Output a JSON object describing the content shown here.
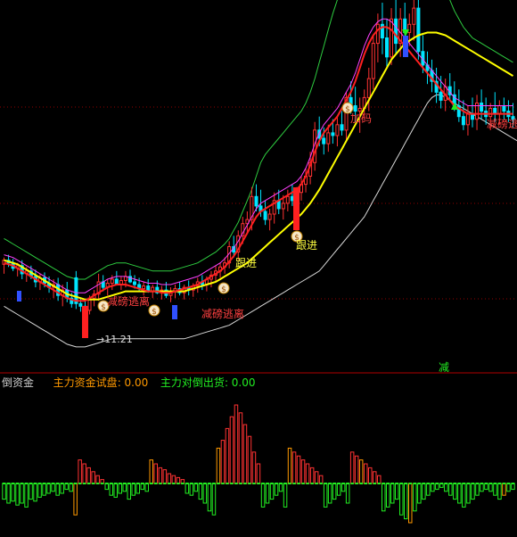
{
  "colors": {
    "background": "#000000",
    "rise": "#ff3232",
    "fall": "#00e5ff",
    "ma_yellow": "#ffff00",
    "ma_red": "#ff2020",
    "ma_magenta": "#ff40ff",
    "band_upper": "#2ecc40",
    "band_lower": "#d8d8d8",
    "separator": "#b00000",
    "grid": "#900000",
    "bar_green": "#22ee22",
    "bar_orange": "#ff9900",
    "label_orange": "#ff9900",
    "label_green": "#22ee22",
    "label_grey": "#cccccc"
  },
  "main_panel": {
    "low_label": "11.21",
    "annotations": [
      {
        "text": "加码",
        "color": "#ff4040"
      },
      {
        "text": "跟进",
        "color": "#ffff40"
      },
      {
        "text": "跟进",
        "color": "#ffff40"
      },
      {
        "text": "减",
        "color": "#22ee22"
      },
      {
        "text": "减磅逃离",
        "color": "#ff4040"
      },
      {
        "text": "减磅逃离",
        "color": "#ff4040"
      },
      {
        "text": "减磅逃离",
        "color": "#ff4040"
      }
    ]
  },
  "sub_panel": {
    "title": "倒资金",
    "items": [
      {
        "label": "主力资金试盘",
        "value": "0.00",
        "color": "#ff9900"
      },
      {
        "label": "主力对倒出货",
        "value": "0.00",
        "color": "#22ee22"
      }
    ]
  },
  "chart_data": {
    "type": "candlestick",
    "candles": [
      {
        "o": 5,
        "h": 10,
        "l": -2,
        "c": 8
      },
      {
        "o": 8,
        "h": 12,
        "l": 3,
        "c": 6
      },
      {
        "o": 6,
        "h": 9,
        "l": 0,
        "c": 2
      },
      {
        "o": 2,
        "h": 6,
        "l": -4,
        "c": 4
      },
      {
        "o": 4,
        "h": 8,
        "l": -6,
        "c": -2
      },
      {
        "o": -2,
        "h": 3,
        "l": -8,
        "c": 0
      },
      {
        "o": 0,
        "h": 4,
        "l": -6,
        "c": -4
      },
      {
        "o": -4,
        "h": 1,
        "l": -12,
        "c": -8
      },
      {
        "o": -8,
        "h": -2,
        "l": -14,
        "c": -5
      },
      {
        "o": -5,
        "h": -1,
        "l": -12,
        "c": -9
      },
      {
        "o": -9,
        "h": -4,
        "l": -16,
        "c": -12
      },
      {
        "o": -12,
        "h": -6,
        "l": -20,
        "c": -10
      },
      {
        "o": -10,
        "h": -5,
        "l": -22,
        "c": -18
      },
      {
        "o": -18,
        "h": -10,
        "l": -26,
        "c": -14
      },
      {
        "o": -14,
        "h": -8,
        "l": -23,
        "c": -20
      },
      {
        "o": -20,
        "h": -16,
        "l": -27,
        "c": -24
      },
      {
        "o": -5,
        "h": 0,
        "l": -28,
        "c": -24
      },
      {
        "o": -24,
        "h": -20,
        "l": -30,
        "c": -26
      },
      {
        "o": -26,
        "h": -22,
        "l": -33,
        "c": -29
      },
      {
        "o": -29,
        "h": -18,
        "l": -32,
        "c": -20
      },
      {
        "o": -20,
        "h": -14,
        "l": -26,
        "c": -17
      },
      {
        "o": -17,
        "h": -2,
        "l": -22,
        "c": -8
      },
      {
        "o": -8,
        "h": -3,
        "l": -15,
        "c": -12
      },
      {
        "o": -12,
        "h": -6,
        "l": -18,
        "c": -9
      },
      {
        "o": -9,
        "h": -3,
        "l": -14,
        "c": -6
      },
      {
        "o": -6,
        "h": 0,
        "l": -10,
        "c": -10
      },
      {
        "o": -10,
        "h": -4,
        "l": -14,
        "c": -7
      },
      {
        "o": -7,
        "h": 0,
        "l": -12,
        "c": -4
      },
      {
        "o": -4,
        "h": 1,
        "l": -9,
        "c": -8
      },
      {
        "o": -8,
        "h": -3,
        "l": -13,
        "c": -10
      },
      {
        "o": -10,
        "h": -5,
        "l": -15,
        "c": -13
      },
      {
        "o": -13,
        "h": -8,
        "l": -18,
        "c": -11
      },
      {
        "o": -11,
        "h": -6,
        "l": -16,
        "c": -15
      },
      {
        "o": -15,
        "h": -10,
        "l": -20,
        "c": -12
      },
      {
        "o": -12,
        "h": -7,
        "l": -17,
        "c": -16
      },
      {
        "o": -16,
        "h": -11,
        "l": -21,
        "c": -14
      },
      {
        "o": -14,
        "h": -8,
        "l": -20,
        "c": -18
      },
      {
        "o": -18,
        "h": -12,
        "l": -23,
        "c": -15
      },
      {
        "o": -15,
        "h": -10,
        "l": -20,
        "c": -13
      },
      {
        "o": -13,
        "h": -8,
        "l": -18,
        "c": -16
      },
      {
        "o": -16,
        "h": -10,
        "l": -21,
        "c": -12
      },
      {
        "o": -12,
        "h": -7,
        "l": -18,
        "c": -14
      },
      {
        "o": -14,
        "h": -9,
        "l": -19,
        "c": -11
      },
      {
        "o": -11,
        "h": -5,
        "l": -16,
        "c": -8
      },
      {
        "o": -8,
        "h": -3,
        "l": -14,
        "c": -10
      },
      {
        "o": -10,
        "h": -4,
        "l": -15,
        "c": -6
      },
      {
        "o": -6,
        "h": 0,
        "l": -12,
        "c": -3
      },
      {
        "o": -3,
        "h": 4,
        "l": -8,
        "c": 0
      },
      {
        "o": 0,
        "h": 6,
        "l": -5,
        "c": 3
      },
      {
        "o": 3,
        "h": 10,
        "l": -2,
        "c": 6
      },
      {
        "o": 6,
        "h": 22,
        "l": 2,
        "c": 18
      },
      {
        "o": 18,
        "h": 26,
        "l": 10,
        "c": 14
      },
      {
        "o": 14,
        "h": 30,
        "l": 8,
        "c": 26
      },
      {
        "o": 26,
        "h": 40,
        "l": 20,
        "c": 35
      },
      {
        "o": 35,
        "h": 44,
        "l": 28,
        "c": 38
      },
      {
        "o": 38,
        "h": 62,
        "l": 30,
        "c": 55
      },
      {
        "o": 55,
        "h": 64,
        "l": 44,
        "c": 48
      },
      {
        "o": 48,
        "h": 60,
        "l": 40,
        "c": 44
      },
      {
        "o": 44,
        "h": 52,
        "l": 34,
        "c": 38
      },
      {
        "o": 38,
        "h": 46,
        "l": 30,
        "c": 42
      },
      {
        "o": 42,
        "h": 58,
        "l": 35,
        "c": 52
      },
      {
        "o": 52,
        "h": 60,
        "l": 42,
        "c": 46
      },
      {
        "o": 46,
        "h": 56,
        "l": 38,
        "c": 50
      },
      {
        "o": 50,
        "h": 60,
        "l": 44,
        "c": 55
      },
      {
        "o": 55,
        "h": 64,
        "l": 48,
        "c": 52
      },
      {
        "o": 52,
        "h": 62,
        "l": 46,
        "c": 58
      },
      {
        "o": 58,
        "h": 70,
        "l": 52,
        "c": 64
      },
      {
        "o": 64,
        "h": 76,
        "l": 58,
        "c": 70
      },
      {
        "o": 70,
        "h": 88,
        "l": 64,
        "c": 80
      },
      {
        "o": 80,
        "h": 110,
        "l": 74,
        "c": 104
      },
      {
        "o": 104,
        "h": 114,
        "l": 92,
        "c": 98
      },
      {
        "o": 98,
        "h": 106,
        "l": 86,
        "c": 94
      },
      {
        "o": 94,
        "h": 108,
        "l": 88,
        "c": 102
      },
      {
        "o": 102,
        "h": 112,
        "l": 94,
        "c": 100
      },
      {
        "o": 100,
        "h": 114,
        "l": 92,
        "c": 108
      },
      {
        "o": 108,
        "h": 118,
        "l": 100,
        "c": 104
      },
      {
        "o": 104,
        "h": 132,
        "l": 96,
        "c": 128
      },
      {
        "o": 128,
        "h": 140,
        "l": 116,
        "c": 122
      },
      {
        "o": 122,
        "h": 136,
        "l": 110,
        "c": 118
      },
      {
        "o": 118,
        "h": 128,
        "l": 102,
        "c": 120
      },
      {
        "o": 120,
        "h": 134,
        "l": 112,
        "c": 128
      },
      {
        "o": 128,
        "h": 150,
        "l": 118,
        "c": 142
      },
      {
        "o": 142,
        "h": 174,
        "l": 134,
        "c": 168
      },
      {
        "o": 168,
        "h": 190,
        "l": 154,
        "c": 182
      },
      {
        "o": 182,
        "h": 198,
        "l": 160,
        "c": 172
      },
      {
        "o": 172,
        "h": 186,
        "l": 150,
        "c": 158
      },
      {
        "o": 158,
        "h": 194,
        "l": 152,
        "c": 186
      },
      {
        "o": 186,
        "h": 200,
        "l": 160,
        "c": 168
      },
      {
        "o": 168,
        "h": 194,
        "l": 158,
        "c": 186
      },
      {
        "o": 186,
        "h": 198,
        "l": 170,
        "c": 176
      },
      {
        "o": 176,
        "h": 190,
        "l": 166,
        "c": 182
      },
      {
        "o": 182,
        "h": 200,
        "l": 170,
        "c": 194
      },
      {
        "o": 194,
        "h": 200,
        "l": 156,
        "c": 162
      },
      {
        "o": 162,
        "h": 174,
        "l": 146,
        "c": 152
      },
      {
        "o": 152,
        "h": 162,
        "l": 138,
        "c": 148
      },
      {
        "o": 148,
        "h": 156,
        "l": 132,
        "c": 140
      },
      {
        "o": 140,
        "h": 150,
        "l": 124,
        "c": 132
      },
      {
        "o": 132,
        "h": 144,
        "l": 120,
        "c": 126
      },
      {
        "o": 126,
        "h": 142,
        "l": 118,
        "c": 136
      },
      {
        "o": 136,
        "h": 146,
        "l": 126,
        "c": 130
      },
      {
        "o": 130,
        "h": 140,
        "l": 118,
        "c": 122
      },
      {
        "o": 122,
        "h": 134,
        "l": 110,
        "c": 114
      },
      {
        "o": 114,
        "h": 126,
        "l": 104,
        "c": 108
      },
      {
        "o": 108,
        "h": 122,
        "l": 100,
        "c": 116
      },
      {
        "o": 116,
        "h": 128,
        "l": 106,
        "c": 112
      },
      {
        "o": 112,
        "h": 130,
        "l": 104,
        "c": 124
      },
      {
        "o": 124,
        "h": 134,
        "l": 112,
        "c": 118
      },
      {
        "o": 118,
        "h": 128,
        "l": 108,
        "c": 114
      },
      {
        "o": 114,
        "h": 124,
        "l": 104,
        "c": 120
      },
      {
        "o": 120,
        "h": 132,
        "l": 110,
        "c": 116
      },
      {
        "o": 116,
        "h": 126,
        "l": 108,
        "c": 122
      },
      {
        "o": 122,
        "h": 128,
        "l": 112,
        "c": 118
      },
      {
        "o": 118,
        "h": 126,
        "l": 110,
        "c": 114
      },
      {
        "o": 114,
        "h": 124,
        "l": 106,
        "c": 112
      }
    ],
    "ma_yellow": [
      8,
      7,
      6,
      5,
      3,
      1,
      -1,
      -3,
      -5,
      -7,
      -9,
      -11,
      -13,
      -15,
      -17,
      -18,
      -19,
      -20,
      -21,
      -21,
      -21,
      -21,
      -20,
      -19,
      -18,
      -17,
      -16,
      -15,
      -15,
      -15,
      -15,
      -15,
      -15,
      -15,
      -15,
      -15,
      -15,
      -15,
      -15,
      -15,
      -15,
      -14,
      -13,
      -12,
      -11,
      -10,
      -9,
      -8,
      -6,
      -4,
      -2,
      0,
      2,
      4,
      6,
      9,
      12,
      15,
      18,
      21,
      24,
      27,
      30,
      33,
      36,
      39,
      42,
      46,
      50,
      55,
      60,
      66,
      72,
      78,
      84,
      90,
      96,
      102,
      108,
      114,
      120,
      126,
      132,
      138,
      144,
      150,
      156,
      160,
      164,
      168,
      170,
      172,
      174,
      175,
      176,
      176,
      176,
      175,
      174,
      172,
      170,
      168,
      166,
      164,
      162,
      160,
      158,
      156,
      154,
      152,
      150,
      148,
      146,
      144
    ],
    "ma_red": [
      6,
      5,
      4,
      2,
      0,
      -2,
      -4,
      -6,
      -8,
      -10,
      -12,
      -14,
      -16,
      -18,
      -20,
      -21,
      -22,
      -22,
      -22,
      -20,
      -18,
      -16,
      -14,
      -12,
      -11,
      -10,
      -10,
      -10,
      -11,
      -12,
      -13,
      -14,
      -15,
      -15,
      -15,
      -16,
      -16,
      -16,
      -15,
      -14,
      -13,
      -12,
      -11,
      -10,
      -8,
      -6,
      -4,
      -2,
      0,
      3,
      7,
      11,
      16,
      22,
      28,
      34,
      40,
      44,
      46,
      48,
      50,
      52,
      54,
      56,
      58,
      60,
      64,
      70,
      78,
      88,
      96,
      102,
      106,
      110,
      114,
      120,
      126,
      132,
      140,
      150,
      160,
      168,
      174,
      178,
      180,
      180,
      178,
      174,
      170,
      166,
      162,
      158,
      154,
      150,
      146,
      142,
      138,
      134,
      130,
      126,
      122,
      120,
      118,
      116,
      116,
      116,
      116,
      116,
      116,
      116,
      116,
      116,
      116,
      116
    ],
    "band_upper": [
      24,
      22,
      20,
      18,
      16,
      14,
      12,
      10,
      8,
      6,
      4,
      2,
      0,
      -2,
      -4,
      -5,
      -6,
      -6,
      -6,
      -4,
      -2,
      0,
      2,
      4,
      5,
      6,
      6,
      6,
      5,
      4,
      3,
      2,
      1,
      0,
      0,
      0,
      0,
      0,
      1,
      2,
      3,
      4,
      5,
      6,
      8,
      10,
      12,
      14,
      17,
      20,
      24,
      30,
      36,
      44,
      52,
      60,
      70,
      80,
      86,
      90,
      94,
      98,
      102,
      106,
      110,
      114,
      118,
      124,
      132,
      142,
      154,
      166,
      178,
      190,
      200,
      210,
      218,
      226,
      232,
      238,
      244,
      250,
      256,
      262,
      268,
      272,
      276,
      278,
      280,
      280,
      278,
      274,
      268,
      260,
      250,
      240,
      230,
      220,
      210,
      200,
      192,
      186,
      180,
      176,
      172,
      170,
      168,
      166,
      164,
      162,
      160,
      158,
      156,
      154
    ],
    "band_lower": [
      -26,
      -28,
      -30,
      -32,
      -34,
      -36,
      -38,
      -40,
      -42,
      -44,
      -46,
      -48,
      -50,
      -52,
      -54,
      -55,
      -56,
      -56,
      -56,
      -55,
      -54,
      -53,
      -52,
      -51,
      -50,
      -50,
      -50,
      -50,
      -50,
      -50,
      -50,
      -50,
      -50,
      -50,
      -50,
      -50,
      -50,
      -50,
      -50,
      -50,
      -50,
      -49,
      -48,
      -47,
      -46,
      -45,
      -44,
      -43,
      -42,
      -41,
      -40,
      -38,
      -36,
      -34,
      -32,
      -30,
      -28,
      -26,
      -24,
      -22,
      -20,
      -18,
      -16,
      -14,
      -12,
      -10,
      -8,
      -6,
      -4,
      -2,
      0,
      4,
      8,
      12,
      16,
      20,
      24,
      28,
      32,
      36,
      40,
      46,
      52,
      58,
      64,
      70,
      76,
      82,
      88,
      94,
      100,
      106,
      112,
      118,
      124,
      128,
      130,
      130,
      128,
      126,
      124,
      122,
      120,
      118,
      116,
      114,
      112,
      110,
      108,
      106,
      104,
      102,
      100,
      98,
      96
    ],
    "sub_bars": [
      -8,
      -10,
      -9,
      -11,
      -10,
      -12,
      -8,
      -9,
      -7,
      -6,
      -5,
      -4,
      -6,
      -5,
      -3,
      -4,
      -16,
      12,
      10,
      8,
      6,
      4,
      2,
      -3,
      -6,
      -7,
      -5,
      -4,
      -8,
      -6,
      -5,
      -3,
      -4,
      12,
      10,
      8,
      7,
      5,
      4,
      3,
      2,
      -5,
      -6,
      -4,
      -8,
      -10,
      -14,
      -16,
      18,
      22,
      28,
      34,
      40,
      36,
      30,
      24,
      16,
      10,
      -12,
      -10,
      -8,
      -6,
      -4,
      -12,
      18,
      16,
      14,
      12,
      10,
      8,
      6,
      4,
      -12,
      -10,
      -8,
      -6,
      -4,
      -10,
      16,
      14,
      12,
      10,
      8,
      6,
      4,
      -14,
      -12,
      -10,
      -8,
      -16,
      -18,
      -20,
      -14,
      -10,
      -8,
      -6,
      -4,
      -3,
      -2,
      -4,
      -6,
      -8,
      -10,
      -12,
      -10,
      -8,
      -6,
      -4,
      -3,
      -4,
      -6,
      -8,
      -6,
      -4,
      -3
    ]
  }
}
